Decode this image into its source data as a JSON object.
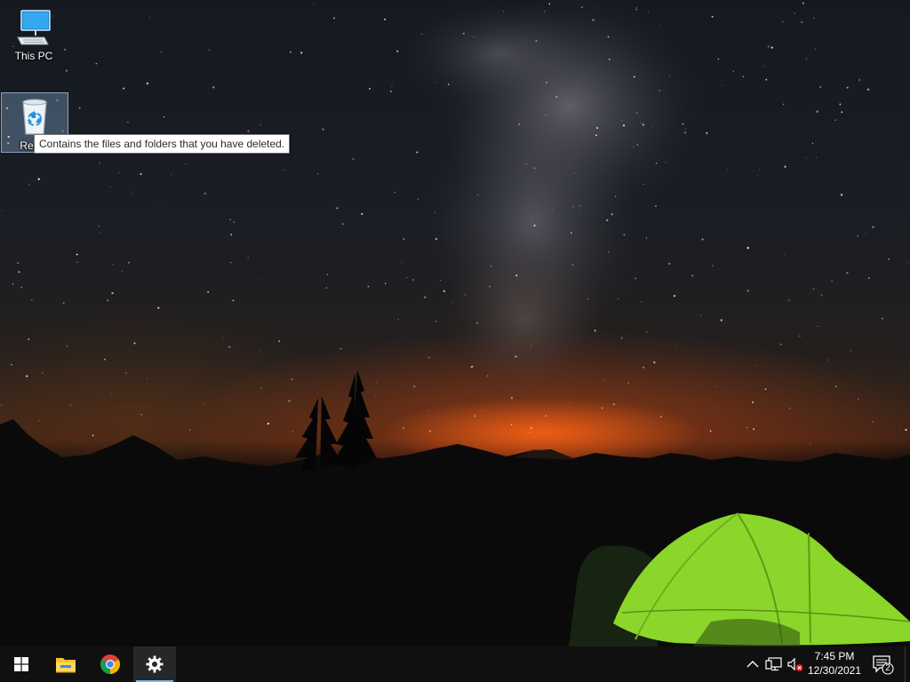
{
  "desktop": {
    "wallpaper": "night-sky-milky-way-tent",
    "icons": [
      {
        "label": "This PC",
        "icon": "this-pc-icon"
      },
      {
        "label": "Recyc",
        "icon": "recycle-bin-icon",
        "selected": true
      }
    ],
    "tooltip": "Contains the files and folders that you have deleted."
  },
  "taskbar": {
    "apps": [
      {
        "name": "Start",
        "icon": "windows-logo-icon"
      },
      {
        "name": "File Explorer",
        "icon": "folder-icon"
      },
      {
        "name": "Google Chrome",
        "icon": "chrome-icon"
      },
      {
        "name": "Settings",
        "icon": "gear-icon",
        "active": true
      }
    ],
    "tray": {
      "icons": [
        "chevron-up-icon",
        "network-icon",
        "volume-muted-icon"
      ]
    },
    "clock": {
      "time": "7:45 PM",
      "date": "12/30/2021"
    },
    "notifications": {
      "icon": "action-center-icon",
      "count": "2"
    }
  },
  "colors": {
    "taskbar_bg": "#101010",
    "accent": "#76b9ed",
    "tent": "#8bd62a",
    "horizon_glow": "#ff6a1a"
  }
}
